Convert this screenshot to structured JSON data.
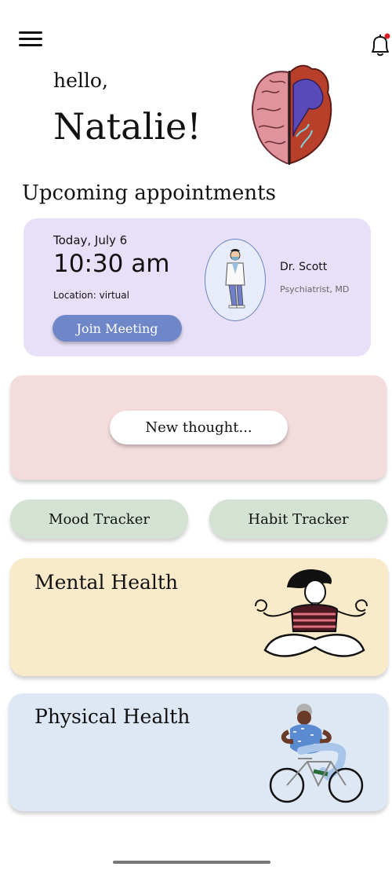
{
  "greeting": {
    "hello": "hello,",
    "name": "Natalie!"
  },
  "section_title": "Upcoming appointments",
  "appointment": {
    "date": "Today, July 6",
    "time": "10:30 am",
    "location": "Location: virtual",
    "join_label": "Join Meeting",
    "doctor_name": "Dr. Scott",
    "doctor_role": "Psychiatrist, MD"
  },
  "thought": {
    "button_label": "New thought..."
  },
  "trackers": {
    "mood": "Mood Tracker",
    "habit": "Habit Tracker"
  },
  "cards": {
    "mental": "Mental Health",
    "physical": "Physical Health"
  },
  "colors": {
    "appointment_bg": "#e7e0f8",
    "join_button": "#6f87c9",
    "thought_bg": "#f4dcdd",
    "tracker_bg": "#d3e2d3",
    "mental_bg": "#f9ebc9",
    "physical_bg": "#dee8f5",
    "notification_dot": "#e02020"
  },
  "icons": {
    "menu": "menu-icon",
    "notifications": "bell-icon"
  }
}
